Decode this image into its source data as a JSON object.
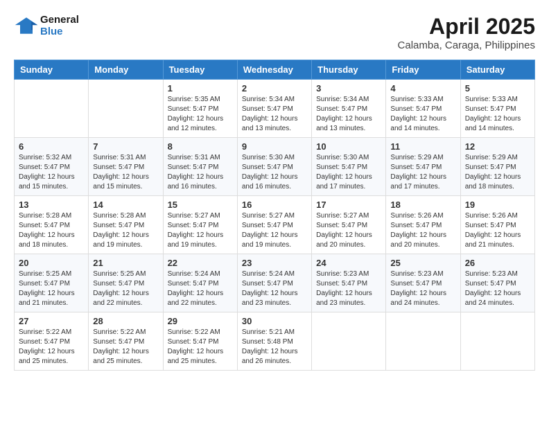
{
  "header": {
    "logo_line1": "General",
    "logo_line2": "Blue",
    "title": "April 2025",
    "subtitle": "Calamba, Caraga, Philippines"
  },
  "days_of_week": [
    "Sunday",
    "Monday",
    "Tuesday",
    "Wednesday",
    "Thursday",
    "Friday",
    "Saturday"
  ],
  "weeks": [
    [
      {
        "day": "",
        "sunrise": "",
        "sunset": "",
        "daylight": ""
      },
      {
        "day": "",
        "sunrise": "",
        "sunset": "",
        "daylight": ""
      },
      {
        "day": "1",
        "sunrise": "Sunrise: 5:35 AM",
        "sunset": "Sunset: 5:47 PM",
        "daylight": "Daylight: 12 hours and 12 minutes."
      },
      {
        "day": "2",
        "sunrise": "Sunrise: 5:34 AM",
        "sunset": "Sunset: 5:47 PM",
        "daylight": "Daylight: 12 hours and 13 minutes."
      },
      {
        "day": "3",
        "sunrise": "Sunrise: 5:34 AM",
        "sunset": "Sunset: 5:47 PM",
        "daylight": "Daylight: 12 hours and 13 minutes."
      },
      {
        "day": "4",
        "sunrise": "Sunrise: 5:33 AM",
        "sunset": "Sunset: 5:47 PM",
        "daylight": "Daylight: 12 hours and 14 minutes."
      },
      {
        "day": "5",
        "sunrise": "Sunrise: 5:33 AM",
        "sunset": "Sunset: 5:47 PM",
        "daylight": "Daylight: 12 hours and 14 minutes."
      }
    ],
    [
      {
        "day": "6",
        "sunrise": "Sunrise: 5:32 AM",
        "sunset": "Sunset: 5:47 PM",
        "daylight": "Daylight: 12 hours and 15 minutes."
      },
      {
        "day": "7",
        "sunrise": "Sunrise: 5:31 AM",
        "sunset": "Sunset: 5:47 PM",
        "daylight": "Daylight: 12 hours and 15 minutes."
      },
      {
        "day": "8",
        "sunrise": "Sunrise: 5:31 AM",
        "sunset": "Sunset: 5:47 PM",
        "daylight": "Daylight: 12 hours and 16 minutes."
      },
      {
        "day": "9",
        "sunrise": "Sunrise: 5:30 AM",
        "sunset": "Sunset: 5:47 PM",
        "daylight": "Daylight: 12 hours and 16 minutes."
      },
      {
        "day": "10",
        "sunrise": "Sunrise: 5:30 AM",
        "sunset": "Sunset: 5:47 PM",
        "daylight": "Daylight: 12 hours and 17 minutes."
      },
      {
        "day": "11",
        "sunrise": "Sunrise: 5:29 AM",
        "sunset": "Sunset: 5:47 PM",
        "daylight": "Daylight: 12 hours and 17 minutes."
      },
      {
        "day": "12",
        "sunrise": "Sunrise: 5:29 AM",
        "sunset": "Sunset: 5:47 PM",
        "daylight": "Daylight: 12 hours and 18 minutes."
      }
    ],
    [
      {
        "day": "13",
        "sunrise": "Sunrise: 5:28 AM",
        "sunset": "Sunset: 5:47 PM",
        "daylight": "Daylight: 12 hours and 18 minutes."
      },
      {
        "day": "14",
        "sunrise": "Sunrise: 5:28 AM",
        "sunset": "Sunset: 5:47 PM",
        "daylight": "Daylight: 12 hours and 19 minutes."
      },
      {
        "day": "15",
        "sunrise": "Sunrise: 5:27 AM",
        "sunset": "Sunset: 5:47 PM",
        "daylight": "Daylight: 12 hours and 19 minutes."
      },
      {
        "day": "16",
        "sunrise": "Sunrise: 5:27 AM",
        "sunset": "Sunset: 5:47 PM",
        "daylight": "Daylight: 12 hours and 19 minutes."
      },
      {
        "day": "17",
        "sunrise": "Sunrise: 5:27 AM",
        "sunset": "Sunset: 5:47 PM",
        "daylight": "Daylight: 12 hours and 20 minutes."
      },
      {
        "day": "18",
        "sunrise": "Sunrise: 5:26 AM",
        "sunset": "Sunset: 5:47 PM",
        "daylight": "Daylight: 12 hours and 20 minutes."
      },
      {
        "day": "19",
        "sunrise": "Sunrise: 5:26 AM",
        "sunset": "Sunset: 5:47 PM",
        "daylight": "Daylight: 12 hours and 21 minutes."
      }
    ],
    [
      {
        "day": "20",
        "sunrise": "Sunrise: 5:25 AM",
        "sunset": "Sunset: 5:47 PM",
        "daylight": "Daylight: 12 hours and 21 minutes."
      },
      {
        "day": "21",
        "sunrise": "Sunrise: 5:25 AM",
        "sunset": "Sunset: 5:47 PM",
        "daylight": "Daylight: 12 hours and 22 minutes."
      },
      {
        "day": "22",
        "sunrise": "Sunrise: 5:24 AM",
        "sunset": "Sunset: 5:47 PM",
        "daylight": "Daylight: 12 hours and 22 minutes."
      },
      {
        "day": "23",
        "sunrise": "Sunrise: 5:24 AM",
        "sunset": "Sunset: 5:47 PM",
        "daylight": "Daylight: 12 hours and 23 minutes."
      },
      {
        "day": "24",
        "sunrise": "Sunrise: 5:23 AM",
        "sunset": "Sunset: 5:47 PM",
        "daylight": "Daylight: 12 hours and 23 minutes."
      },
      {
        "day": "25",
        "sunrise": "Sunrise: 5:23 AM",
        "sunset": "Sunset: 5:47 PM",
        "daylight": "Daylight: 12 hours and 24 minutes."
      },
      {
        "day": "26",
        "sunrise": "Sunrise: 5:23 AM",
        "sunset": "Sunset: 5:47 PM",
        "daylight": "Daylight: 12 hours and 24 minutes."
      }
    ],
    [
      {
        "day": "27",
        "sunrise": "Sunrise: 5:22 AM",
        "sunset": "Sunset: 5:47 PM",
        "daylight": "Daylight: 12 hours and 25 minutes."
      },
      {
        "day": "28",
        "sunrise": "Sunrise: 5:22 AM",
        "sunset": "Sunset: 5:47 PM",
        "daylight": "Daylight: 12 hours and 25 minutes."
      },
      {
        "day": "29",
        "sunrise": "Sunrise: 5:22 AM",
        "sunset": "Sunset: 5:47 PM",
        "daylight": "Daylight: 12 hours and 25 minutes."
      },
      {
        "day": "30",
        "sunrise": "Sunrise: 5:21 AM",
        "sunset": "Sunset: 5:48 PM",
        "daylight": "Daylight: 12 hours and 26 minutes."
      },
      {
        "day": "",
        "sunrise": "",
        "sunset": "",
        "daylight": ""
      },
      {
        "day": "",
        "sunrise": "",
        "sunset": "",
        "daylight": ""
      },
      {
        "day": "",
        "sunrise": "",
        "sunset": "",
        "daylight": ""
      }
    ]
  ]
}
